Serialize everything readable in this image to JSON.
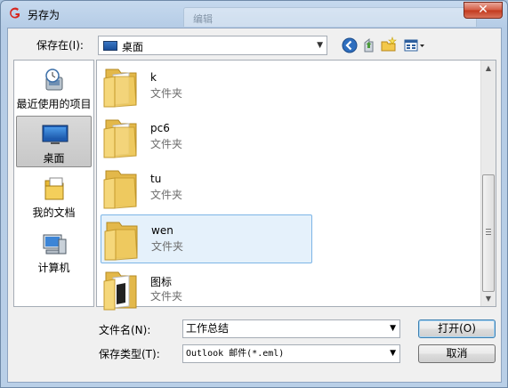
{
  "window": {
    "title": "另存为",
    "background_tab_title": "编辑"
  },
  "toolbar": {
    "save_in_label": "保存在(I):",
    "save_in_value": "桌面"
  },
  "places": [
    {
      "label": "最近使用的项目",
      "icon": "recent-items-icon"
    },
    {
      "label": "桌面",
      "icon": "desktop-icon",
      "active": true
    },
    {
      "label": "我的文档",
      "icon": "my-documents-icon"
    },
    {
      "label": "计算机",
      "icon": "computer-icon"
    }
  ],
  "files": [
    {
      "name": "k",
      "type": "文件夹"
    },
    {
      "name": "pc6",
      "type": "文件夹"
    },
    {
      "name": "tu",
      "type": "文件夹"
    },
    {
      "name": "wen",
      "type": "文件夹",
      "selected": true
    },
    {
      "name": "图标",
      "type": "文件夹"
    }
  ],
  "form": {
    "filename_label": "文件名(N):",
    "filename_value": "工作总结",
    "filetype_label": "保存类型(T):",
    "filetype_value": "Outlook 邮件(*.eml)"
  },
  "buttons": {
    "open": "打开(O)",
    "cancel": "取消"
  },
  "colors": {
    "selection_bg": "#e5f1fb",
    "selection_border": "#7db5e6",
    "close_red": "#c2381d"
  }
}
